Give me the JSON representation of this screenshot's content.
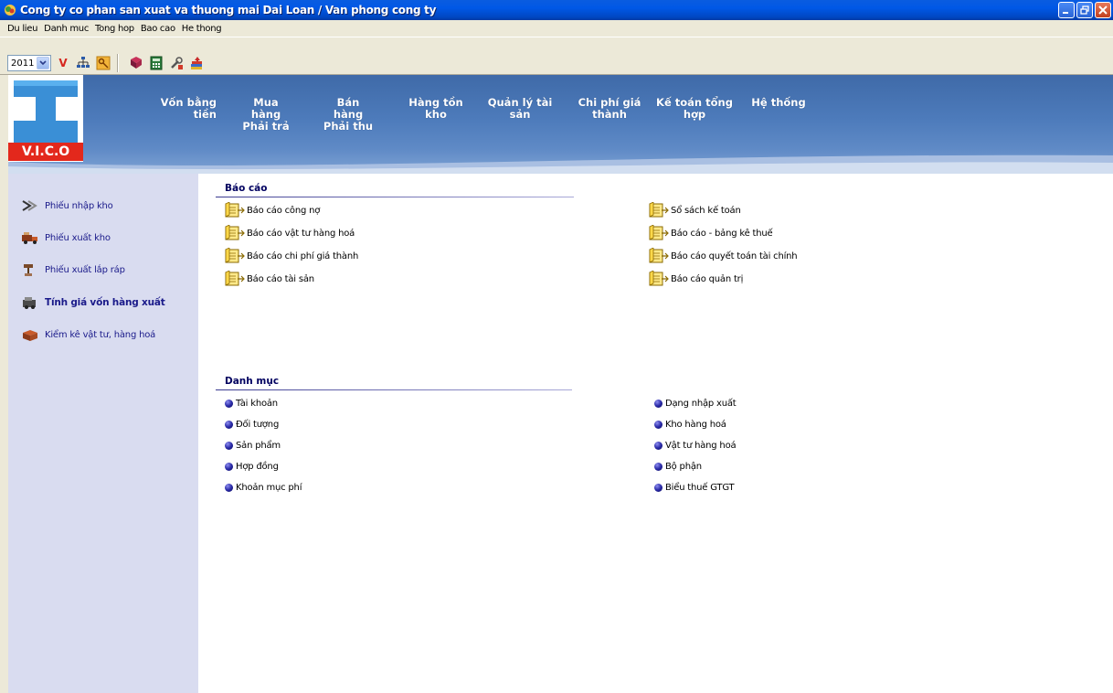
{
  "window": {
    "title": "Cong ty co phan san xuat va thuong mai Dai Loan / Van phong cong ty"
  },
  "menu": [
    "Du lieu",
    "Danh muc",
    "Tong hop",
    "Bao cao",
    "He thong"
  ],
  "toolbar": {
    "year": "2011",
    "icons": [
      "v-icon",
      "network-icon",
      "key-icon",
      "book-icon",
      "calculator-icon",
      "tools-icon",
      "books-stack-icon"
    ],
    "v_label": "V"
  },
  "logo": {
    "text": "V.I.C.O"
  },
  "nav": [
    "Vốn bằng\ntiền",
    "Mua hàng\nPhải trả",
    "Bán hàng\nPhải thu",
    "Hàng tồn\nkho",
    "Quản lý tài\nsản",
    "Chi phí giá\nthành",
    "Kế toán tổng\nhợp",
    "Hệ thống"
  ],
  "sidebar": [
    {
      "label": "Phiếu nhập kho",
      "icon": "arrow-in-icon"
    },
    {
      "label": "Phiếu xuất kho",
      "icon": "truck-icon"
    },
    {
      "label": "Phiếu xuất lắp ráp",
      "icon": "assembly-icon"
    },
    {
      "label": "Tính giá vốn hàng xuất",
      "icon": "cost-calc-icon"
    },
    {
      "label": "Kiểm kê vật tư, hàng hoá",
      "icon": "inventory-box-icon"
    }
  ],
  "reports": {
    "title": "Báo cáo",
    "left": [
      "Báo cáo công nợ",
      "Báo cáo vật tư hàng hoá",
      "Báo cáo chi phí giá thành",
      "Báo cáo tài sản"
    ],
    "right": [
      "Sổ sách kế toán",
      "Báo cáo - bảng kê thuế",
      "Báo cáo quyết toán tài chính",
      "Báo cáo quản trị"
    ]
  },
  "categories": {
    "title": "Danh mục",
    "left": [
      "Tài khoản",
      "Đối tượng",
      "Sản phẩm",
      "Hợp đồng",
      "Khoản mục phí"
    ],
    "right": [
      "Dạng nhập xuất",
      "Kho hàng hoá",
      "Vật tư hàng hoá",
      "Bộ phận",
      "Biểu thuế GTGT"
    ]
  },
  "colors": {
    "titlebar": "#0058e6",
    "banner": "#4d7bbb",
    "sidebar": "#d9dcf0",
    "logo_red": "#e3281c",
    "link_blue": "#1a1a8a"
  }
}
